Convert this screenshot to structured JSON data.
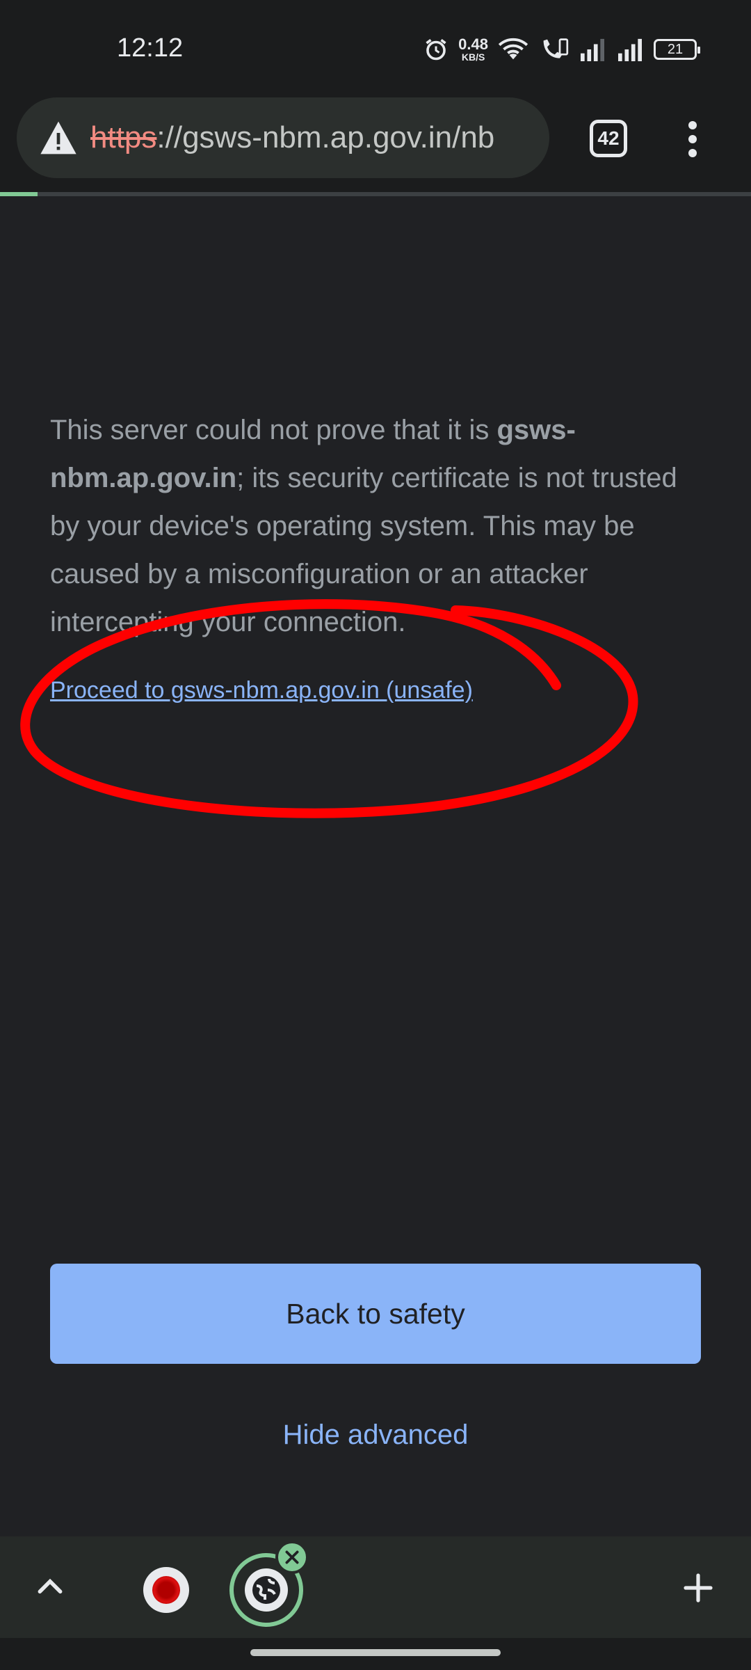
{
  "status_bar": {
    "time": "12:12",
    "net_speed_value": "0.48",
    "net_speed_unit": "KB/S",
    "battery": "21",
    "icons": [
      "alarm-icon",
      "wifi-icon",
      "wifi-calling-icon",
      "signal-icon",
      "signal-icon"
    ]
  },
  "toolbar": {
    "url_scheme": "https",
    "url_rest": "://gsws-nbm.ap.gov.in/nb",
    "tab_count": "42",
    "loading_progress": 0.05,
    "icons": [
      "warning-icon",
      "menu-icon"
    ]
  },
  "interstitial": {
    "text_before": "This server could not prove that it is ",
    "domain_bold": "gsws-nbm.ap.gov.in",
    "text_after": "; its security certificate is not trusted by your device's operating system. This may be caused by a misconfiguration or an attacker intercepting your connection.",
    "proceed_link": "Proceed to gsws-nbm.ap.gov.in (unsafe)",
    "back_button": "Back to safety",
    "hide_advanced": "Hide advanced"
  },
  "bottom_bar": {
    "icons": [
      "chevron-up-icon",
      "tab-thumbnail",
      "active-tab-thumbnail",
      "close-icon",
      "plus-icon"
    ]
  },
  "colors": {
    "background": "#202124",
    "link": "#8ab4f8",
    "annotation": "#ff0000",
    "accent_green": "#81c995"
  }
}
